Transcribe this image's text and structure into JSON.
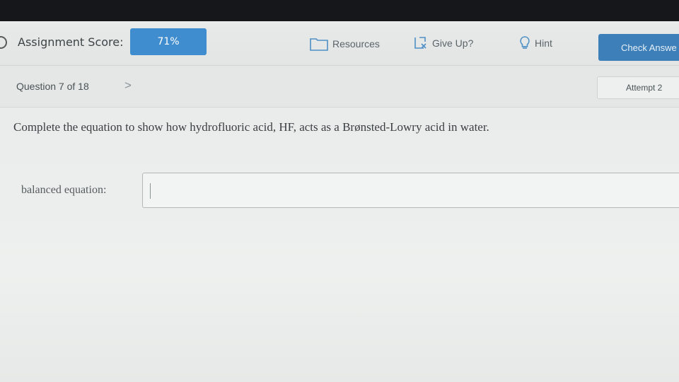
{
  "header": {
    "score_label": "Assignment Score:",
    "score_value": "71%",
    "resources_label": "Resources",
    "giveup_label": "Give Up?",
    "hint_label": "Hint",
    "check_label": "Check Answe"
  },
  "subbar": {
    "question_label": "Question 7 of 18",
    "next_glyph": ">",
    "attempt_label": "Attempt 2"
  },
  "content": {
    "question_text": "Complete the equation to show how hydrofluoric acid, HF, acts as a Brønsted-Lowry acid in water.",
    "equation_label": "balanced equation:",
    "equation_value": ""
  },
  "colors": {
    "score_box": "#3f8dcf",
    "check_button": "#3c7fb9",
    "top_bar": "#15171a"
  }
}
